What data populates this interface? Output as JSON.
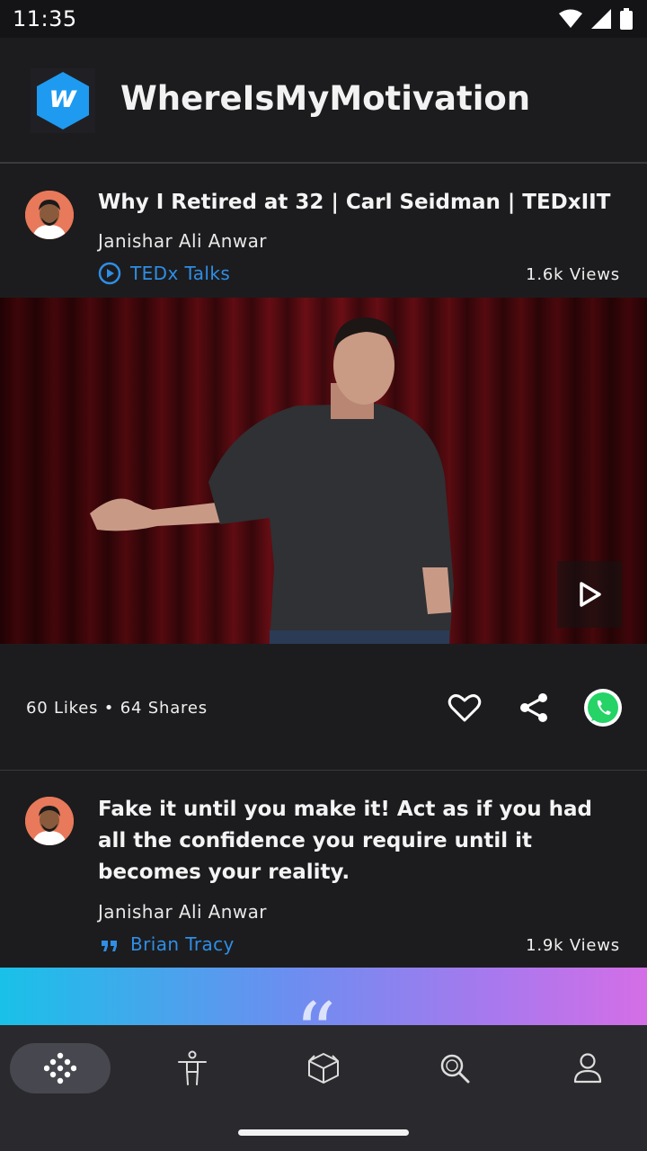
{
  "status_bar": {
    "time": "11:35",
    "icons": [
      "wifi-icon",
      "cell-signal-icon",
      "battery-icon"
    ]
  },
  "app": {
    "logo_letter": "w",
    "title": "WhereIsMyMotivation",
    "accent": "#1e9bf0"
  },
  "posts": [
    {
      "title": "Why I Retired at 32 | Carl Seidman | TEDxIIT",
      "author": "Janishar Ali Anwar",
      "source": "TEDx Talks",
      "source_icon": "play-circle-icon",
      "views": "1.6k Views",
      "media": "video",
      "engagement": "60 Likes • 64 Shares"
    },
    {
      "title": "Fake it until you make it! Act as if you had all the confidence you require until it becomes your reality.",
      "author": "Janishar Ali Anwar",
      "source": "Brian Tracy",
      "source_icon": "quote-icon",
      "views": "1.9k Views",
      "media": "quote",
      "banner_glyph": "“"
    }
  ],
  "actions": [
    "heart-icon",
    "share-icon",
    "whatsapp-icon"
  ],
  "bottom_nav": [
    {
      "name": "nav-home",
      "icon": "dots-grid-icon",
      "active": true
    },
    {
      "name": "nav-motivation",
      "icon": "person-icon",
      "active": false
    },
    {
      "name": "nav-library",
      "icon": "box-icon",
      "active": false
    },
    {
      "name": "nav-search",
      "icon": "search-icon",
      "active": false
    },
    {
      "name": "nav-profile",
      "icon": "profile-icon",
      "active": false
    }
  ],
  "colors": {
    "background": "#1c1c1e",
    "link": "#2f8ee5",
    "whatsapp": "#25d366",
    "nav_bg": "#2a2a2e"
  }
}
